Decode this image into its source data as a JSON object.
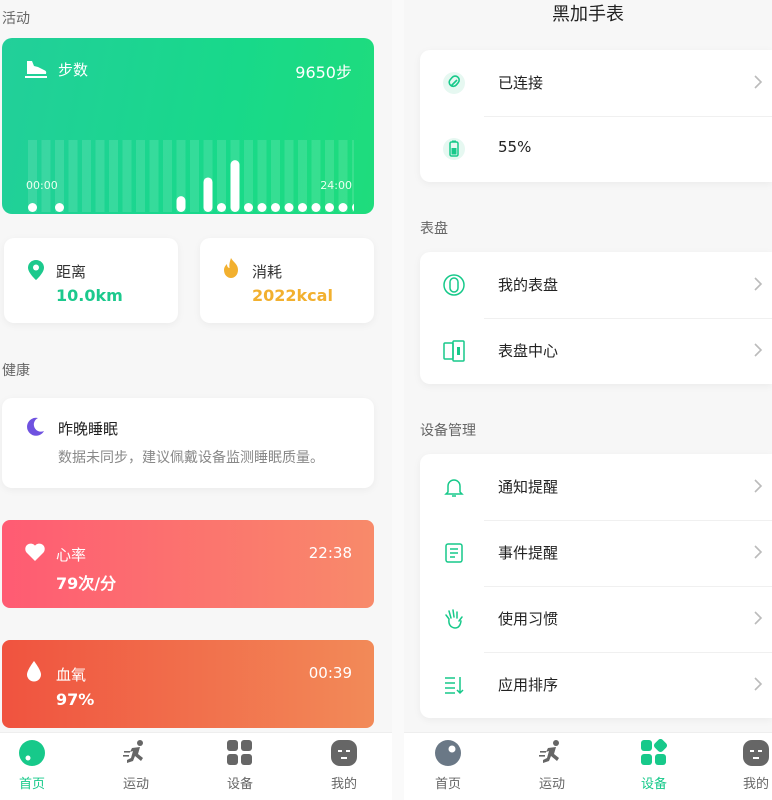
{
  "left": {
    "activity_label": "活动",
    "steps": {
      "title": "步数",
      "value": "9650步",
      "axis_start": "00:00",
      "axis_end": "24:00",
      "hourly_levels": [
        0.08,
        0,
        0.08,
        0,
        0,
        0,
        0,
        0,
        0,
        0,
        0,
        0.22,
        0,
        0.48,
        0.08,
        0.72,
        0.1,
        0.1,
        0.1,
        0.1,
        0.1,
        0.1,
        0.1,
        0.1,
        0.1
      ]
    },
    "distance": {
      "label": "距离",
      "value": "10.0km",
      "color": "#1cc98d"
    },
    "calories": {
      "label": "消耗",
      "value": "2022kcal",
      "color": "#f2b02f"
    },
    "health_label": "健康",
    "sleep": {
      "title": "昨晚睡眠",
      "desc": "数据未同步，建议佩戴设备监测睡眠质量。"
    },
    "heart": {
      "title": "心率",
      "value": "79次/分",
      "time": "22:38"
    },
    "oxygen": {
      "title": "血氧",
      "value": "97%",
      "time": "00:39"
    },
    "tabs": [
      {
        "label": "首页",
        "icon": "home-icon"
      },
      {
        "label": "运动",
        "icon": "runner-icon"
      },
      {
        "label": "设备",
        "icon": "device-grid-icon"
      },
      {
        "label": "我的",
        "icon": "profile-icon"
      }
    ]
  },
  "right": {
    "title": "黑加手表",
    "connection": "已连接",
    "battery": "55%",
    "watchface_section": "表盘",
    "my_watchface": "我的表盘",
    "watchface_center": "表盘中心",
    "device_section": "设备管理",
    "notifications": "通知提醒",
    "event_reminder": "事件提醒",
    "usage_habits": "使用习惯",
    "app_order": "应用排序",
    "tabs": [
      {
        "label": "首页",
        "icon": "home-icon"
      },
      {
        "label": "运动",
        "icon": "runner-icon"
      },
      {
        "label": "设备",
        "icon": "device-grid-icon"
      },
      {
        "label": "我的",
        "icon": "profile-icon"
      }
    ]
  },
  "colors": {
    "accent": "#17c98a",
    "heart_start": "#ff5b73",
    "heart_end": "#f88a6a",
    "oxygen_start": "#f0533f",
    "oxygen_end": "#f28a58"
  }
}
